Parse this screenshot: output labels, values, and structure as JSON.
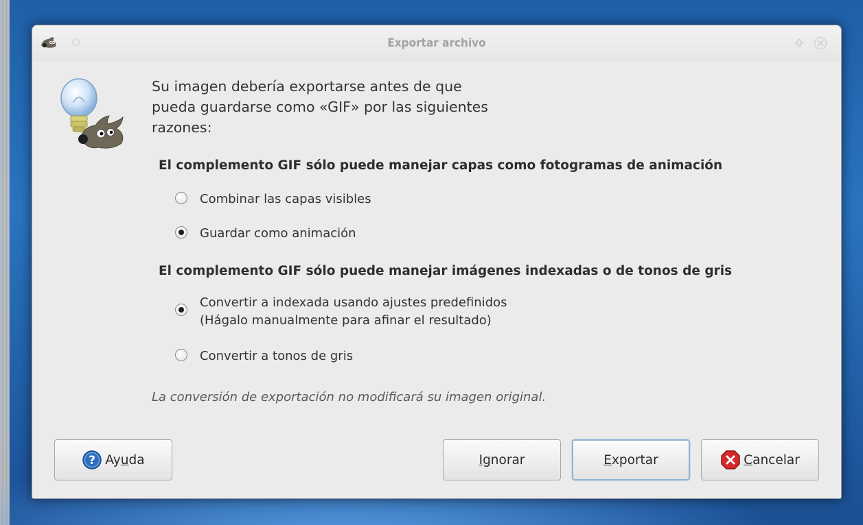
{
  "window": {
    "title": "Exportar archivo"
  },
  "intro": {
    "line1": "Su imagen debería exportarse antes de que",
    "line2": "pueda guardarse como «GIF» por las siguientes",
    "line3": "razones:"
  },
  "sections": [
    {
      "heading": "El complemento GIF sólo puede manejar capas como fotogramas de animación",
      "options": [
        {
          "label": "Combinar las capas visibles",
          "checked": false
        },
        {
          "label": "Guardar como animación",
          "checked": true
        }
      ]
    },
    {
      "heading": "El complemento GIF sólo puede manejar imágenes indexadas o de tonos de gris",
      "options": [
        {
          "label": "Convertir a indexada usando ajustes predefinidos",
          "label2": "(Hágalo manualmente para afinar el resultado)",
          "checked": true
        },
        {
          "label": "Convertir a tonos de gris",
          "checked": false
        }
      ]
    }
  ],
  "note": "La conversión de exportación no modificará su imagen original.",
  "buttons": {
    "help": {
      "pre": "Ay",
      "mnemonic": "u",
      "post": "da",
      "icon": "help-icon"
    },
    "ignore": {
      "pre": "",
      "mnemonic": "I",
      "post": "gnorar"
    },
    "export": {
      "pre": "",
      "mnemonic": "E",
      "post": "xportar"
    },
    "cancel": {
      "pre": "",
      "mnemonic": "C",
      "post": "ancelar",
      "icon": "cancel-icon"
    }
  },
  "colors": {
    "window_bg": "#ebebeb",
    "default_button_border": "#8fb3d6",
    "help_icon": "#2f6fbf",
    "cancel_icon": "#d42a2a"
  }
}
